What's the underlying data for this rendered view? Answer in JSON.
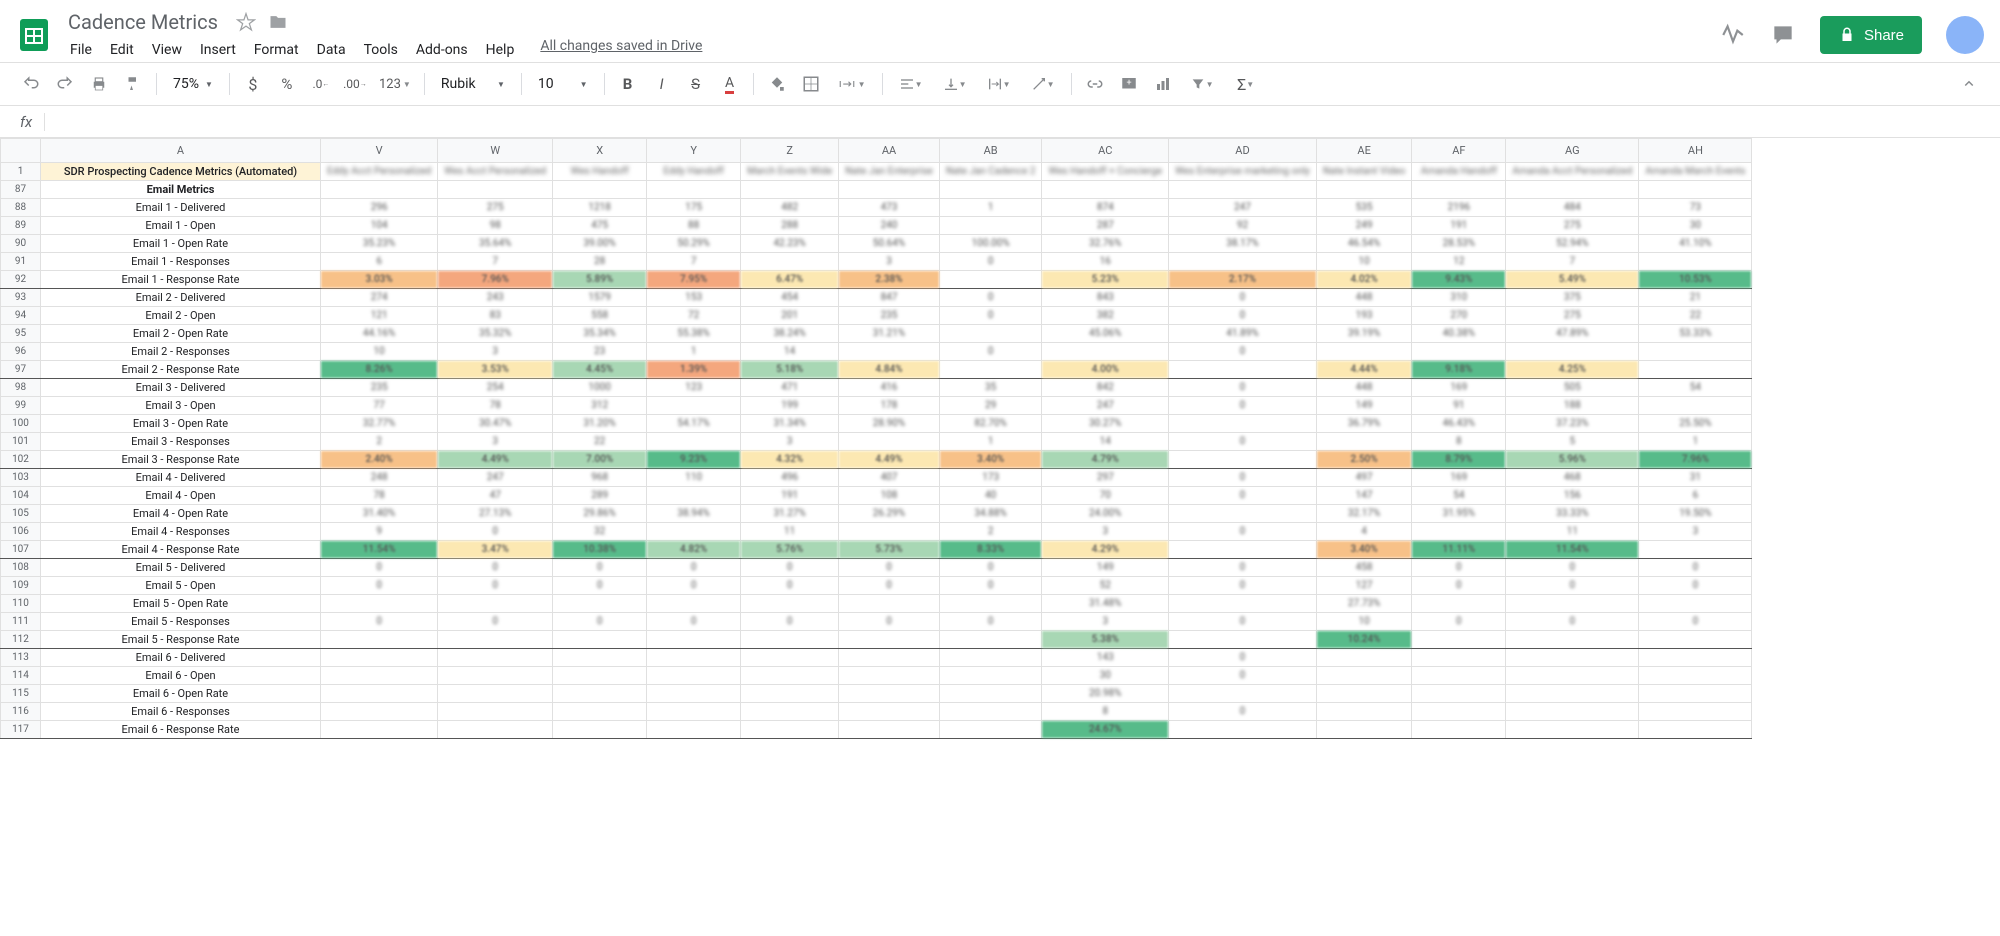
{
  "doc": {
    "title": "Cadence Metrics",
    "save_status": "All changes saved in Drive"
  },
  "menubar": [
    "File",
    "Edit",
    "View",
    "Insert",
    "Format",
    "Data",
    "Tools",
    "Add-ons",
    "Help"
  ],
  "share_label": "Share",
  "toolbar": {
    "zoom": "75%",
    "font": "Rubik",
    "font_size": "10",
    "decimal_dec": ".0",
    "decimal_inc": ".00",
    "num_format": "123"
  },
  "fx_label": "fx",
  "columns": [
    "",
    "A",
    "V",
    "W",
    "X",
    "Y",
    "Z",
    "AA",
    "AB",
    "AC",
    "AD",
    "AE",
    "AF",
    "AG",
    "AH"
  ],
  "column_headers": [
    "",
    "",
    "Eddy Acct Personalized",
    "Wes Acct Personalized",
    "Wes Handoff",
    "Eddy Handoff",
    "March Events Wide",
    "Nate Jan Enterprise",
    "Nate Jan Cadence 2",
    "Wes Handoff + Concierge",
    "Wes Enterprise marketing only",
    "Nate Instant Video",
    "Amanda Handoff",
    "Amanda Acct Personalized",
    "Amanda March Events"
  ],
  "rows": [
    {
      "num": "1",
      "label": "SDR Prospecting Cadence Metrics (Automated)",
      "type": "title"
    },
    {
      "num": "87",
      "label": "Email Metrics",
      "type": "section"
    },
    {
      "num": "88",
      "label": "Email 1 - Delivered",
      "type": "data",
      "data": [
        "296",
        "275",
        "1218",
        "175",
        "482",
        "473",
        "1",
        "874",
        "247",
        "535",
        "2196",
        "484",
        "73"
      ]
    },
    {
      "num": "89",
      "label": "Email 1 - Open",
      "type": "data",
      "data": [
        "104",
        "98",
        "475",
        "88",
        "288",
        "240",
        "",
        "287",
        "92",
        "249",
        "191",
        "275",
        "30"
      ]
    },
    {
      "num": "90",
      "label": "Email 1 - Open Rate",
      "type": "data",
      "data": [
        "35.23%",
        "35.64%",
        "39.00%",
        "50.29%",
        "42.23%",
        "50.64%",
        "100.00%",
        "32.76%",
        "38.17%",
        "46.54%",
        "28.53%",
        "52.94%",
        "41.10%"
      ]
    },
    {
      "num": "91",
      "label": "Email 1 - Responses",
      "type": "data",
      "data": [
        "6",
        "7",
        "28",
        "7",
        "",
        "3",
        "0",
        "16",
        "",
        "10",
        "12",
        "7",
        ""
      ]
    },
    {
      "num": "92",
      "label": "Email 1 - Response Rate",
      "type": "rate",
      "data": [
        "3.03%",
        "7.96%",
        "5.89%",
        "7.95%",
        "6.47%",
        "2.38%",
        "",
        "5.23%",
        "2.17%",
        "4.02%",
        "9.43%",
        "5.49%",
        "10.53%"
      ],
      "colors": [
        "orange",
        "red",
        "lightgreen",
        "red",
        "yellow",
        "orange",
        "",
        "yellow",
        "orange",
        "yellow",
        "green",
        "yellow",
        "green"
      ]
    },
    {
      "num": "93",
      "label": "Email 2 - Delivered",
      "type": "data",
      "data": [
        "274",
        "243",
        "1579",
        "153",
        "454",
        "847",
        "0",
        "843",
        "0",
        "448",
        "310",
        "375",
        "21"
      ]
    },
    {
      "num": "94",
      "label": "Email 2 - Open",
      "type": "data",
      "data": [
        "121",
        "83",
        "558",
        "72",
        "201",
        "235",
        "0",
        "382",
        "0",
        "193",
        "270",
        "275",
        "22"
      ]
    },
    {
      "num": "95",
      "label": "Email 2 - Open Rate",
      "type": "data",
      "data": [
        "44.16%",
        "35.32%",
        "35.34%",
        "55.38%",
        "38.24%",
        "31.21%",
        "",
        "45.06%",
        "41.89%",
        "39.19%",
        "40.38%",
        "47.89%",
        "53.33%"
      ]
    },
    {
      "num": "96",
      "label": "Email 2 - Responses",
      "type": "data",
      "data": [
        "10",
        "3",
        "23",
        "1",
        "14",
        "",
        "0",
        "",
        "0",
        "",
        "",
        "",
        ""
      ]
    },
    {
      "num": "97",
      "label": "Email 2 - Response Rate",
      "type": "rate",
      "data": [
        "8.26%",
        "3.53%",
        "4.45%",
        "1.39%",
        "5.18%",
        "4.84%",
        "",
        "4.00%",
        "",
        "4.44%",
        "9.18%",
        "4.25%",
        ""
      ],
      "colors": [
        "green",
        "yellow",
        "lightgreen",
        "red",
        "lightgreen",
        "yellow",
        "",
        "yellow",
        "",
        "yellow",
        "green",
        "yellow",
        ""
      ]
    },
    {
      "num": "98",
      "label": "Email 3 - Delivered",
      "type": "data",
      "data": [
        "235",
        "254",
        "1000",
        "123",
        "471",
        "416",
        "35",
        "842",
        "0",
        "448",
        "169",
        "505",
        "54"
      ]
    },
    {
      "num": "99",
      "label": "Email 3 - Open",
      "type": "data",
      "data": [
        "77",
        "78",
        "312",
        "",
        "199",
        "178",
        "29",
        "247",
        "0",
        "149",
        "91",
        "188",
        ""
      ]
    },
    {
      "num": "100",
      "label": "Email 3 - Open Rate",
      "type": "data",
      "data": [
        "32.77%",
        "30.47%",
        "31.20%",
        "54.17%",
        "31.34%",
        "28.90%",
        "82.70%",
        "30.27%",
        "",
        "36.79%",
        "46.43%",
        "37.23%",
        "25.50%"
      ]
    },
    {
      "num": "101",
      "label": "Email 3 - Responses",
      "type": "data",
      "data": [
        "2",
        "3",
        "22",
        "",
        "3",
        "",
        "1",
        "14",
        "0",
        "",
        "8",
        "5",
        "1"
      ]
    },
    {
      "num": "102",
      "label": "Email 3 - Response Rate",
      "type": "rate",
      "data": [
        "2.40%",
        "4.49%",
        "7.00%",
        "9.23%",
        "4.32%",
        "4.49%",
        "3.40%",
        "4.79%",
        "",
        "2.50%",
        "8.79%",
        "5.96%",
        "7.96%"
      ],
      "colors": [
        "orange",
        "lightgreen",
        "lightgreen",
        "green",
        "yellow",
        "yellow",
        "orange",
        "lightgreen",
        "",
        "orange",
        "green",
        "lightgreen",
        "green"
      ]
    },
    {
      "num": "103",
      "label": "Email 4 - Delivered",
      "type": "data",
      "data": [
        "248",
        "247",
        "968",
        "110",
        "496",
        "407",
        "173",
        "297",
        "0",
        "497",
        "169",
        "468",
        "31"
      ]
    },
    {
      "num": "104",
      "label": "Email 4 - Open",
      "type": "data",
      "data": [
        "78",
        "47",
        "289",
        "",
        "191",
        "108",
        "40",
        "70",
        "0",
        "147",
        "54",
        "156",
        "6"
      ]
    },
    {
      "num": "105",
      "label": "Email 4 - Open Rate",
      "type": "data",
      "data": [
        "31.40%",
        "27.13%",
        "29.86%",
        "38.94%",
        "31.27%",
        "26.29%",
        "34.88%",
        "24.00%",
        "",
        "32.17%",
        "31.95%",
        "33.33%",
        "19.50%"
      ]
    },
    {
      "num": "106",
      "label": "Email 4 - Responses",
      "type": "data",
      "data": [
        "9",
        "0",
        "32",
        "",
        "11",
        "",
        "2",
        "3",
        "0",
        "4",
        "",
        "11",
        "3"
      ]
    },
    {
      "num": "107",
      "label": "Email 4 - Response Rate",
      "type": "rate",
      "data": [
        "11.54%",
        "3.47%",
        "10.38%",
        "4.82%",
        "5.76%",
        "5.73%",
        "8.33%",
        "4.29%",
        "",
        "3.40%",
        "11.11%",
        "11.54%",
        ""
      ],
      "colors": [
        "green",
        "yellow",
        "green",
        "lightgreen",
        "lightgreen",
        "lightgreen",
        "green",
        "yellow",
        "",
        "orange",
        "green",
        "green",
        ""
      ]
    },
    {
      "num": "108",
      "label": "Email 5 - Delivered",
      "type": "data",
      "data": [
        "0",
        "0",
        "0",
        "0",
        "0",
        "0",
        "0",
        "149",
        "0",
        "458",
        "0",
        "0",
        "0"
      ]
    },
    {
      "num": "109",
      "label": "Email 5 - Open",
      "type": "data",
      "data": [
        "0",
        "0",
        "0",
        "0",
        "0",
        "0",
        "0",
        "52",
        "0",
        "127",
        "0",
        "0",
        "0"
      ]
    },
    {
      "num": "110",
      "label": "Email 5 - Open Rate",
      "type": "data",
      "data": [
        "",
        "",
        "",
        "",
        "",
        "",
        "",
        "31.48%",
        "",
        "27.73%",
        "",
        "",
        ""
      ]
    },
    {
      "num": "111",
      "label": "Email 5 - Responses",
      "type": "data",
      "data": [
        "0",
        "0",
        "0",
        "0",
        "0",
        "0",
        "0",
        "3",
        "0",
        "10",
        "0",
        "0",
        "0"
      ]
    },
    {
      "num": "112",
      "label": "Email 5 - Response Rate",
      "type": "rate",
      "data": [
        "",
        "",
        "",
        "",
        "",
        "",
        "",
        "5.38%",
        "",
        "10.24%",
        "",
        "",
        ""
      ],
      "colors": [
        "",
        "",
        "",
        "",
        "",
        "",
        "",
        "lightgreen",
        "",
        "green",
        "",
        "",
        ""
      ]
    },
    {
      "num": "113",
      "label": "Email 6 - Delivered",
      "type": "data",
      "data": [
        "",
        "",
        "",
        "",
        "",
        "",
        "",
        "143",
        "0",
        "",
        "",
        "",
        ""
      ]
    },
    {
      "num": "114",
      "label": "Email 6 - Open",
      "type": "data",
      "data": [
        "",
        "",
        "",
        "",
        "",
        "",
        "",
        "30",
        "0",
        "",
        "",
        "",
        ""
      ]
    },
    {
      "num": "115",
      "label": "Email 6 - Open Rate",
      "type": "data",
      "data": [
        "",
        "",
        "",
        "",
        "",
        "",
        "",
        "20.98%",
        "",
        "",
        "",
        "",
        ""
      ]
    },
    {
      "num": "116",
      "label": "Email 6 - Responses",
      "type": "data",
      "data": [
        "",
        "",
        "",
        "",
        "",
        "",
        "",
        "8",
        "0",
        "",
        "",
        "",
        ""
      ]
    },
    {
      "num": "117",
      "label": "Email 6 - Response Rate",
      "type": "rate",
      "data": [
        "",
        "",
        "",
        "",
        "",
        "",
        "",
        "24.67%",
        "",
        "",
        "",
        "",
        ""
      ],
      "colors": [
        "",
        "",
        "",
        "",
        "",
        "",
        "",
        "green",
        "",
        "",
        "",
        "",
        ""
      ]
    }
  ]
}
